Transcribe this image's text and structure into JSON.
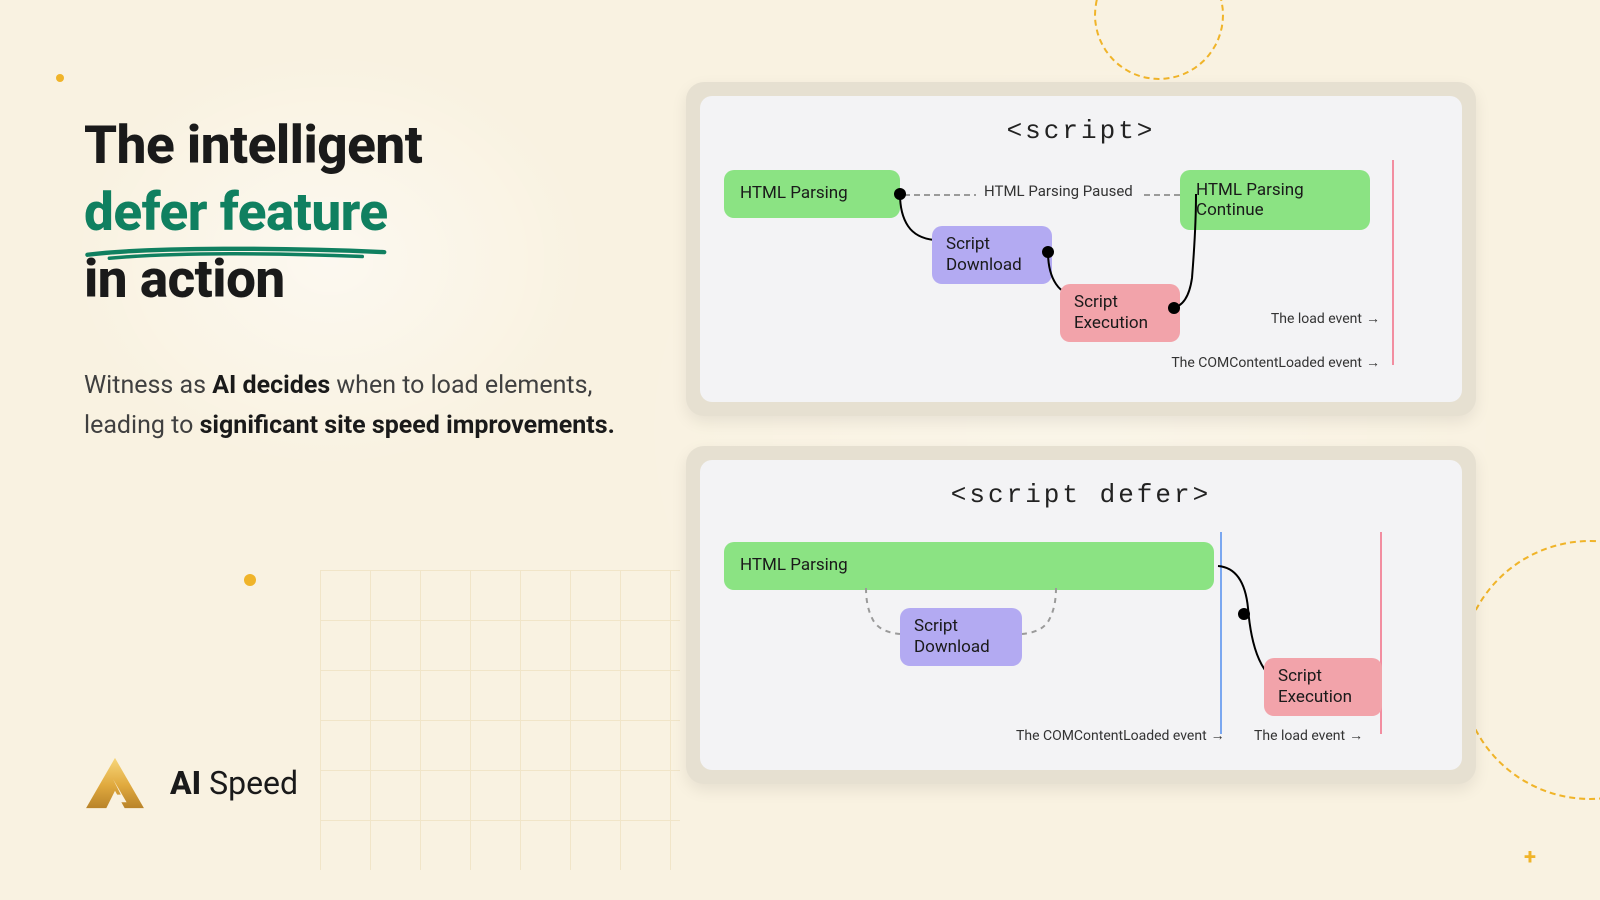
{
  "heading": {
    "line1": "The intelligent",
    "accent": "defer feature",
    "line3": "in action"
  },
  "subhead": {
    "t1": "Witness as ",
    "b1": "AI decides",
    "t2": " when to load elements, leading to ",
    "b2": "significant site speed improvements."
  },
  "brand": {
    "bold": "AI",
    "rest": " Speed"
  },
  "panel1": {
    "title": "<script>",
    "blocks": {
      "html_parsing": "HTML Parsing",
      "paused_label": "HTML Parsing Paused",
      "script_download": "Script Download",
      "script_execution": "Script Execution",
      "html_continue": "HTML Parsing Continue"
    },
    "notes": {
      "load": "The load event",
      "dom": "The COMContentLoaded event"
    }
  },
  "panel2": {
    "title": "<script defer>",
    "blocks": {
      "html_parsing": "HTML Parsing",
      "script_download": "Script Download",
      "script_execution": "Script Execution"
    },
    "notes": {
      "dom": "The COMContentLoaded event",
      "load": "The load event"
    }
  }
}
